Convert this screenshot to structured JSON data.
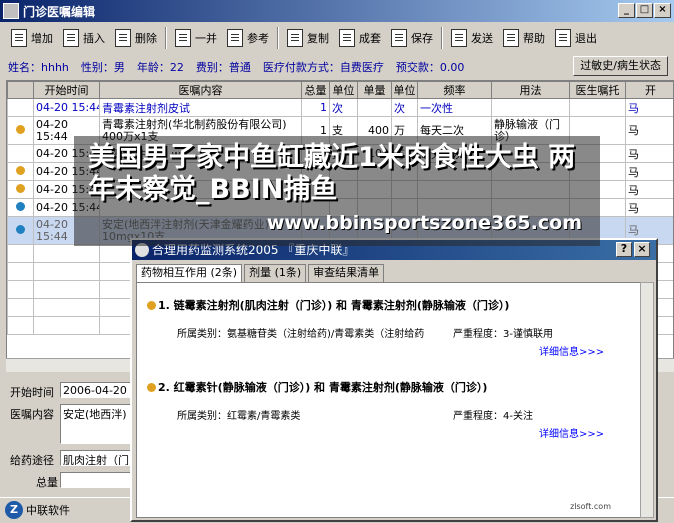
{
  "window": {
    "title": "门诊医嘱编辑",
    "controls": [
      "_",
      "□",
      "×"
    ]
  },
  "toolbar": [
    {
      "label": "增加",
      "icon": "add-doc-icon"
    },
    {
      "label": "插入",
      "icon": "insert-doc-icon"
    },
    {
      "label": "删除",
      "icon": "delete-doc-icon"
    },
    {
      "label": "一并",
      "icon": "merge-doc-icon"
    },
    {
      "label": "参考",
      "icon": "reference-icon"
    },
    {
      "label": "复制",
      "icon": "copy-icon"
    },
    {
      "label": "成套",
      "icon": "set-icon"
    },
    {
      "label": "保存",
      "icon": "save-icon"
    },
    {
      "label": "发送",
      "icon": "send-icon"
    },
    {
      "label": "帮助",
      "icon": "help-icon"
    },
    {
      "label": "退出",
      "icon": "exit-icon"
    }
  ],
  "patient": {
    "name": "姓名：hhhh",
    "sex": "性别：男",
    "age": "年龄：22",
    "fee_type": "费别：普通",
    "payment": "医疗付款方式：自费医疗",
    "prepay": "预交款：0.00",
    "history_button": "过敏史/病生状态"
  },
  "grid": {
    "columns": [
      "开始时间",
      "医嘱内容",
      "总量",
      "单位",
      "单量",
      "单位",
      "频率",
      "用法",
      "医生嘱托",
      "开"
    ],
    "rows": [
      {
        "dot": "",
        "time": "04-20 15:44",
        "content": "青霉素注射剂皮试",
        "total": "1",
        "unit": "次",
        "dose": "",
        "dunit": "次",
        "freq": "一次性",
        "usage": "",
        "note": "",
        "doc": "马",
        "blue": true
      },
      {
        "dot": "#e0a020",
        "time": "04-20 15:44",
        "content": "青霉素注射剂(华北制药股份有限公司) 400万x1支",
        "total": "1",
        "unit": "支",
        "dose": "400",
        "dunit": "万",
        "freq": "每天二次",
        "usage": "静脉输液（门诊）",
        "note": "",
        "doc": "马",
        "tall": true
      },
      {
        "dot": "",
        "time": "04-20 15:44",
        "content": "链霉素注射剂 wu",
        "total": "1",
        "unit": "支",
        "dose": "100",
        "dunit": "万",
        "freq": "每天二次",
        "usage": "",
        "note": "",
        "doc": "马"
      },
      {
        "dot": "#e0a020",
        "time": "04-20 15:44",
        "content": "",
        "total": "",
        "unit": "",
        "dose": "",
        "dunit": "",
        "freq": "",
        "usage": "",
        "note": "",
        "doc": "马"
      },
      {
        "dot": "#e0a020",
        "time": "04-20 15:44",
        "content": "",
        "total": "",
        "unit": "",
        "dose": "",
        "dunit": "",
        "freq": "",
        "usage": "",
        "note": "",
        "doc": "马"
      },
      {
        "dot": "#2080c0",
        "time": "04-20 15:44",
        "content": "",
        "total": "",
        "unit": "",
        "dose": "",
        "dunit": "",
        "freq": "",
        "usage": "",
        "note": "",
        "doc": "马"
      },
      {
        "dot": "#2080c0",
        "time": "04-20 15:44",
        "content": "安定(地西泮注射剂(天津金耀药业) 10mgx10支",
        "total": "",
        "unit": "",
        "dose": "",
        "dunit": "",
        "freq": "",
        "usage": "",
        "note": "",
        "doc": "马",
        "tall": true,
        "sel": true
      }
    ]
  },
  "detail": {
    "start_label": "开始时间",
    "start_value": "2006-04-20 1",
    "content_label": "医嘱内容",
    "content_value": "安定(地西泮)",
    "route_label": "给药途径",
    "route_value": "肌肉注射（门",
    "total_label": "总量"
  },
  "status": {
    "text": "中联软件",
    "logo": "Z"
  },
  "dialog": {
    "title": "合理用药监测系统2005 『重庆中联』",
    "help": "?",
    "close": "×",
    "tabs": [
      "药物相互作用 (2条)",
      "剂量 (1条)",
      "审查结果清单"
    ],
    "items": [
      {
        "title": "1. 链霉素注射剂(肌肉注射（门诊）) 和 青霉素注射剂(静脉输液（门诊）)",
        "category": "所属类别：氨基糖苷类（注射给药)/青霉素类（注射给药",
        "severity": "严重程度：3-谨慎联用",
        "more": "详细信息>>>",
        "dot": "#e0a020"
      },
      {
        "title": "2. 红霉素针(静脉输液（门诊）) 和 青霉素注射剂(静脉输液（门诊）)",
        "category": "所属类别：红霉素/青霉素类",
        "severity": "严重程度：4-关注",
        "more": "详细信息>>>",
        "dot": "#e0a020"
      }
    ],
    "watermark": "zlsoft.com"
  },
  "banner": {
    "headline": "美国男子家中鱼缸藏近1米肉食性大虫 两年未察觉_BBIN捕鱼",
    "url": "www.bbinsportszone365.com"
  }
}
